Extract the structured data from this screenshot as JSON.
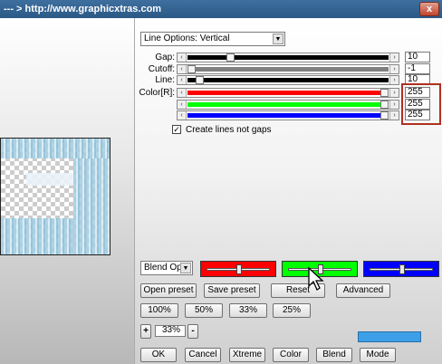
{
  "window": {
    "title": "--- > http://www.graphicxtras.com",
    "close_symbol": "x"
  },
  "line_options": {
    "selected": "Line Options: Vertical"
  },
  "sliders": [
    {
      "label": "Gap:",
      "value": "10",
      "fill_color": "#000000",
      "position_fraction": 0.2
    },
    {
      "label": "Cutoff:",
      "value": "-1",
      "fill_color": "#808080",
      "position_fraction": 0.0
    },
    {
      "label": "Line:",
      "value": "10",
      "fill_color": "#000000",
      "position_fraction": 0.04
    },
    {
      "label": "Color[R]:",
      "value": "255",
      "fill_color": "#ff0000",
      "position_fraction": 1.0
    },
    {
      "label": "",
      "value": "255",
      "fill_color": "#00ff00",
      "position_fraction": 1.0
    },
    {
      "label": "",
      "value": "255",
      "fill_color": "#0000ff",
      "position_fraction": 1.0
    }
  ],
  "checkbox": {
    "label": "Create lines not gaps",
    "checked": true,
    "mark": "✓"
  },
  "blend": {
    "selected": "Blend Optio"
  },
  "color_bars": [
    {
      "name": "red",
      "color": "#ff0000",
      "knob_fraction": 0.5
    },
    {
      "name": "green",
      "color": "#00ff00",
      "knob_fraction": 0.5
    },
    {
      "name": "blue",
      "color": "#0000ff",
      "knob_fraction": 0.5
    }
  ],
  "preset_buttons": {
    "open": "Open preset",
    "save": "Save preset",
    "reset": "Reset",
    "advanced": "Advanced"
  },
  "zoom_buttons": [
    "100%",
    "50%",
    "33%",
    "25%"
  ],
  "zoom": {
    "plus": "+",
    "value": "33%",
    "minus": "-"
  },
  "swatch_color": "#3d9fe8",
  "bottom_buttons": {
    "ok": "OK",
    "cancel": "Cancel",
    "xtreme": "Xtreme",
    "color": "Color",
    "blend": "Blend",
    "mode": "Mode"
  }
}
